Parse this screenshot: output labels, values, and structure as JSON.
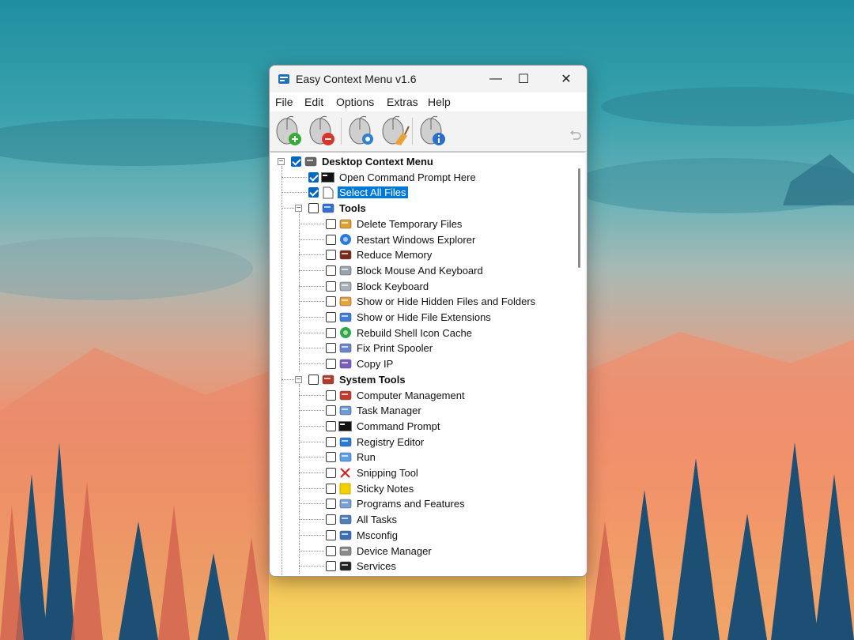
{
  "window": {
    "title": "Easy Context Menu v1.6",
    "minimize": "—",
    "maximize": "☐",
    "close": "✕"
  },
  "menu": [
    "File",
    "Edit",
    "Options",
    "Extras",
    "Help"
  ],
  "toolbar": {
    "buttons": [
      {
        "name": "add-to-context-menu",
        "icon": "mouse-plus-icon"
      },
      {
        "name": "remove-from-context-menu",
        "icon": "mouse-minus-icon"
      },
      {
        "name": "context-menu-settings",
        "icon": "mouse-gear-icon"
      },
      {
        "name": "context-menu-cleaner",
        "icon": "mouse-broom-icon"
      },
      {
        "name": "about",
        "icon": "mouse-info-icon"
      }
    ],
    "undo_icon": "undo-icon"
  },
  "tree": {
    "root": {
      "label": "Desktop Context Menu",
      "checked": true,
      "expander": "−"
    },
    "top_items": [
      {
        "label": "Open Command Prompt Here",
        "checked": true,
        "icon": "console-icon"
      },
      {
        "label": "Select All Files",
        "checked": true,
        "selected": true,
        "icon": "document-icon"
      }
    ],
    "groups": [
      {
        "label": "Tools",
        "checked": false,
        "expander": "−",
        "icon": "tools-arrow-icon",
        "items": [
          {
            "label": "Delete Temporary Files",
            "icon": "broom-icon"
          },
          {
            "label": "Restart Windows Explorer",
            "icon": "globe-icon"
          },
          {
            "label": "Reduce Memory",
            "icon": "memory-chip-icon"
          },
          {
            "label": "Block Mouse And Keyboard",
            "icon": "block-keyboard-mouse-icon"
          },
          {
            "label": "Block Keyboard",
            "icon": "block-keyboard-icon"
          },
          {
            "label": "Show or Hide Hidden Files and Folders",
            "icon": "hidden-files-icon"
          },
          {
            "label": "Show or Hide File Extensions",
            "icon": "file-extensions-icon"
          },
          {
            "label": "Rebuild Shell Icon Cache",
            "icon": "refresh-icon"
          },
          {
            "label": "Fix Print Spooler",
            "icon": "printer-icon"
          },
          {
            "label": "Copy IP",
            "icon": "ip-icon"
          }
        ]
      },
      {
        "label": "System Tools",
        "checked": false,
        "expander": "−",
        "icon": "wrench-hammer-icon",
        "items": [
          {
            "label": "Computer Management",
            "icon": "computer-management-icon"
          },
          {
            "label": "Task Manager",
            "icon": "task-manager-icon"
          },
          {
            "label": "Command Prompt",
            "icon": "console-icon"
          },
          {
            "label": "Registry Editor",
            "icon": "registry-icon"
          },
          {
            "label": "Run",
            "icon": "run-icon"
          },
          {
            "label": "Snipping Tool",
            "icon": "scissors-icon"
          },
          {
            "label": "Sticky Notes",
            "icon": "sticky-note-icon"
          },
          {
            "label": "Programs and Features",
            "icon": "programs-icon"
          },
          {
            "label": "All Tasks",
            "icon": "control-panel-icon"
          },
          {
            "label": "Msconfig",
            "icon": "msconfig-icon"
          },
          {
            "label": "Device Manager",
            "icon": "device-manager-icon"
          },
          {
            "label": "Services",
            "icon": "services-icon"
          }
        ]
      }
    ]
  },
  "colors": {
    "accent": "#0078d7",
    "check": "#0067c0"
  }
}
